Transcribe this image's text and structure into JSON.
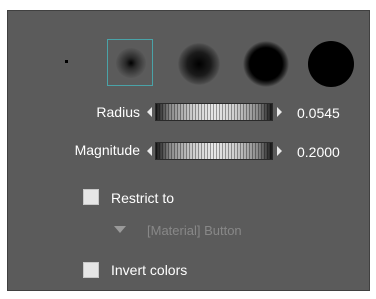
{
  "brushes": [
    {
      "name": "brush-point-icon",
      "selected": false
    },
    {
      "name": "brush-soft-small-icon",
      "selected": true
    },
    {
      "name": "brush-soft-medium-icon",
      "selected": false
    },
    {
      "name": "brush-soft-large-icon",
      "selected": false
    },
    {
      "name": "brush-hard-large-icon",
      "selected": false
    }
  ],
  "sliders": {
    "radius": {
      "label": "Radius",
      "value": "0.0545"
    },
    "magnitude": {
      "label": "Magnitude",
      "value": "0.2000"
    }
  },
  "restrict": {
    "label": "Restrict to",
    "checked": false
  },
  "material_dropdown": {
    "value": "[Material] Button"
  },
  "invert": {
    "label": "Invert colors",
    "checked": false
  },
  "colors": {
    "panel_bg": "#5b5b5b",
    "selection_frame": "#4aa3a8",
    "text": "#ffffff",
    "disabled_text": "#888888"
  }
}
